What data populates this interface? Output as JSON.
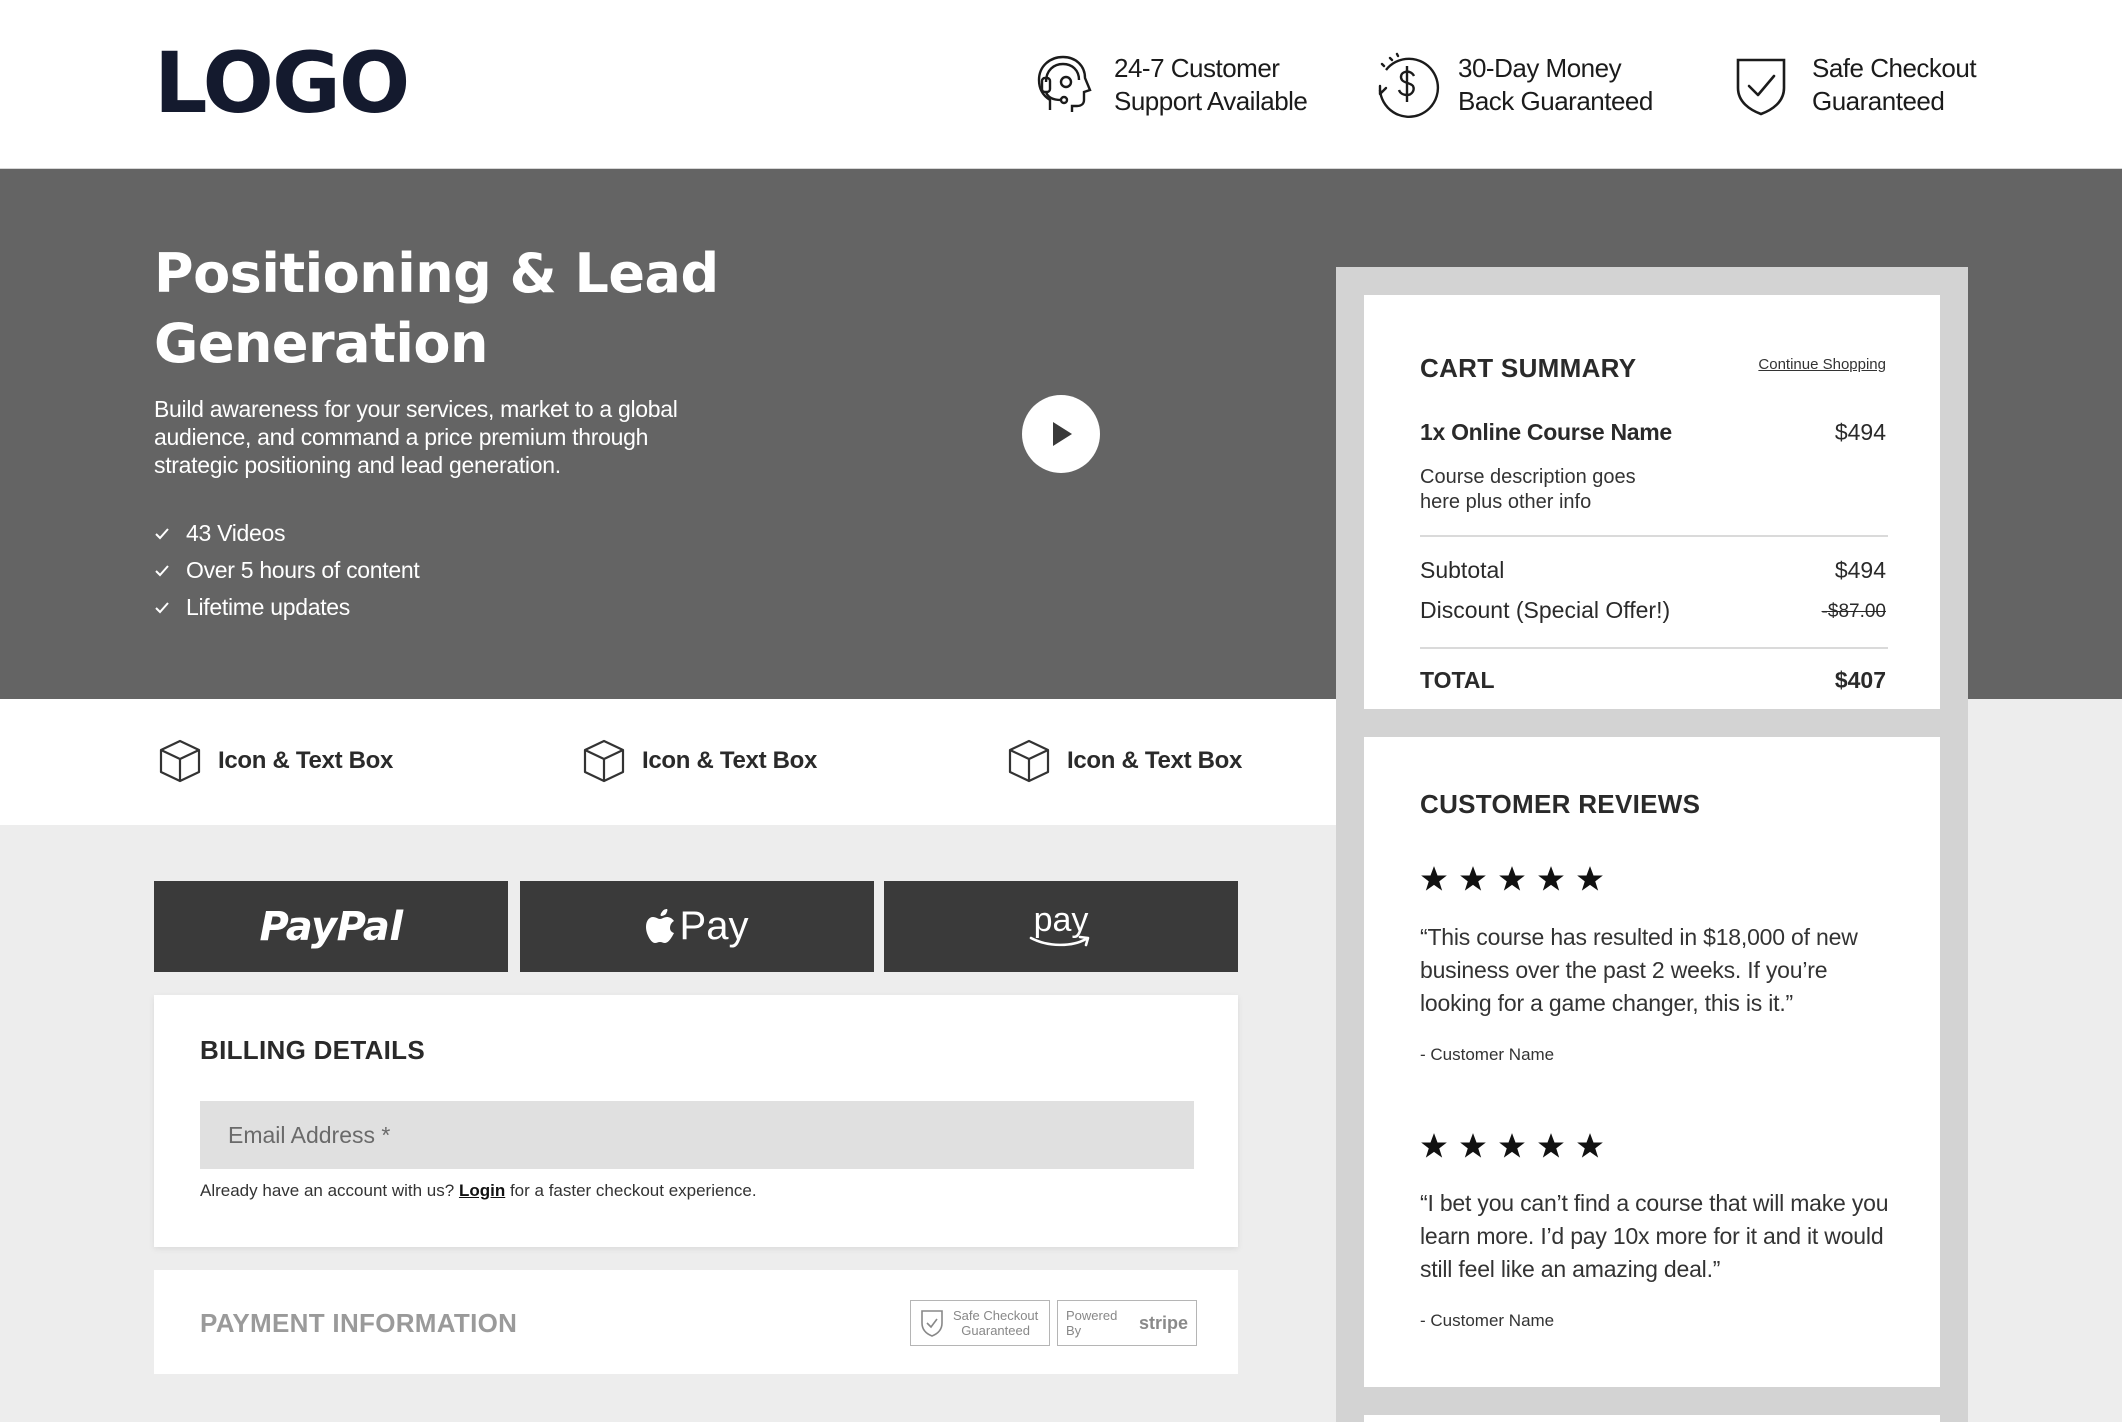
{
  "header": {
    "logo": "LOGO",
    "badges": [
      {
        "icon": "headset-icon",
        "text": "24-7 Customer\nSupport Available"
      },
      {
        "icon": "money-back-icon",
        "text": "30-Day Money\nBack Guaranteed"
      },
      {
        "icon": "shield-check-icon",
        "text": "Safe Checkout\nGuaranteed"
      }
    ]
  },
  "hero": {
    "title": "Positioning & Lead Generation",
    "description": "Build awareness for your services, market to a global audience, and command a price premium through strategic positioning and lead generation.",
    "bullets": [
      "43 Videos",
      "Over 5 hours of content",
      "Lifetime updates"
    ]
  },
  "features": [
    "Icon & Text Box",
    "Icon & Text Box",
    "Icon & Text Box"
  ],
  "payment_buttons": {
    "paypal": "PayPal",
    "apple_pay": "Pay",
    "amazon_pay": "pay"
  },
  "billing": {
    "title": "BILLING DETAILS",
    "email_placeholder": "Email Address *",
    "account_prefix": "Already have an account with us?",
    "login_link": "Login",
    "account_suffix": "for a faster checkout experience."
  },
  "payment": {
    "title": "PAYMENT INFORMATION",
    "safe_badge": "Safe Checkout\nGuaranteed",
    "powered_by": "Powered By",
    "stripe": "stripe"
  },
  "cart": {
    "title": "CART SUMMARY",
    "continue_link": "Continue Shopping",
    "item_name": "1x Online Course Name",
    "item_price": "$494",
    "item_desc": "Course description goes here plus other info",
    "subtotal_label": "Subtotal",
    "subtotal_value": "$494",
    "discount_label": "Discount (Special Offer!)",
    "discount_value": "-$87.00",
    "total_label": "TOTAL",
    "total_value": "$407"
  },
  "reviews": {
    "title": "CUSTOMER REVIEWS",
    "items": [
      {
        "rating": 5,
        "quote": "“This course has resulted in $18,000 of new business over the past 2 weeks. If you’re looking for a game changer, this is it.”",
        "author": "- Customer Name"
      },
      {
        "rating": 5,
        "quote": "“I bet you can’t find a course that will make you learn more. I’d pay 10x more for it and it would still feel like an amazing deal.”",
        "author": "- Customer Name"
      }
    ]
  }
}
